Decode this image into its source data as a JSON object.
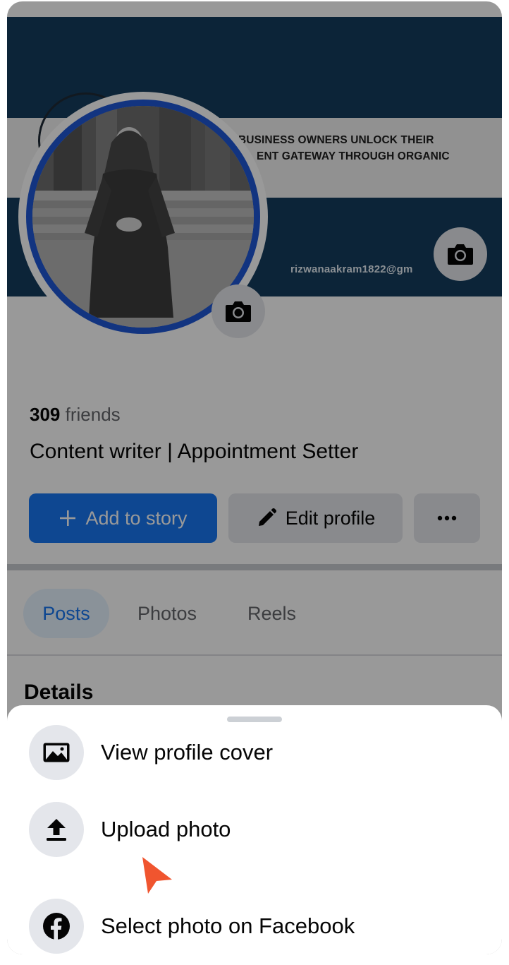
{
  "cover": {
    "line1": "BUSINESS OWNERS UNLOCK THEIR",
    "line2": "ENT GATEWAY THROUGH ORGANIC",
    "email": "rizwanaakram1822@gm",
    "change_cover_icon": "camera-icon"
  },
  "profile": {
    "change_photo_icon": "camera-icon",
    "friends_count": "309",
    "friends_label": "friends",
    "bio": "Content writer | Appointment Setter"
  },
  "actions": {
    "add_story_icon": "plus-icon",
    "add_story_label": "Add to story",
    "edit_profile_icon": "pencil-icon",
    "edit_profile_label": "Edit profile",
    "more_icon": "ellipsis-icon"
  },
  "tabs": [
    {
      "label": "Posts",
      "active": true
    },
    {
      "label": "Photos",
      "active": false
    },
    {
      "label": "Reels",
      "active": false
    }
  ],
  "section_title": "Details",
  "sheet": {
    "items": [
      {
        "label": "View profile cover",
        "icon": "image-icon"
      },
      {
        "label": "Upload photo",
        "icon": "upload-icon"
      },
      {
        "label": "Select photo on Facebook",
        "icon": "facebook-icon"
      }
    ]
  },
  "colors": {
    "accent": "#1877f2",
    "cover_navy": "#143c5e",
    "avatar_ring": "#1f57d6",
    "pointer": "#f0552f"
  }
}
